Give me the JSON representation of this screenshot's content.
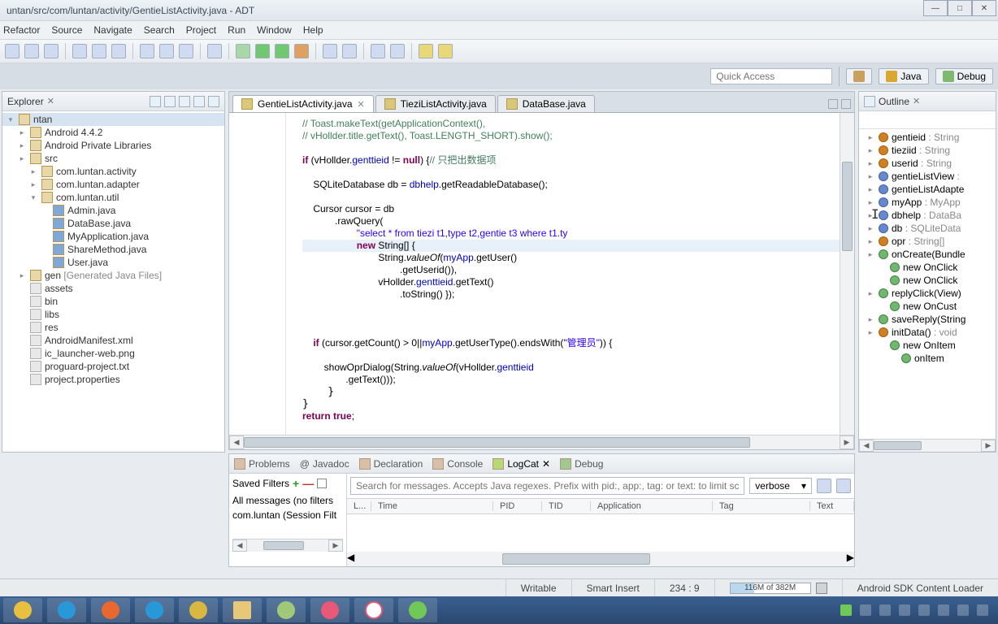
{
  "window": {
    "title": "untan/src/com/luntan/activity/GentieListActivity.java - ADT"
  },
  "menu": {
    "refactor": "Refactor",
    "source": "Source",
    "navigate": "Navigate",
    "search": "Search",
    "project": "Project",
    "run": "Run",
    "window": "Window",
    "help": "Help"
  },
  "perspective": {
    "quick_access": "Quick Access",
    "java": "Java",
    "debug": "Debug"
  },
  "explorer": {
    "title": "Explorer",
    "root": "ntan",
    "items": [
      {
        "l": 1,
        "k": "pkg",
        "t": "Android 4.4.2"
      },
      {
        "l": 1,
        "k": "pkg",
        "t": "Android Private Libraries"
      },
      {
        "l": 1,
        "k": "pkg",
        "t": "src"
      },
      {
        "l": 2,
        "k": "pkg",
        "t": "com.luntan.activity"
      },
      {
        "l": 2,
        "k": "pkg",
        "t": "com.luntan.adapter"
      },
      {
        "l": 2,
        "k": "pkg",
        "t": "com.luntan.util",
        "open": true
      },
      {
        "l": 3,
        "k": "java",
        "t": "Admin.java"
      },
      {
        "l": 3,
        "k": "java",
        "t": "DataBase.java"
      },
      {
        "l": 3,
        "k": "java",
        "t": "MyApplication.java"
      },
      {
        "l": 3,
        "k": "java",
        "t": "ShareMethod.java"
      },
      {
        "l": 3,
        "k": "java",
        "t": "User.java"
      },
      {
        "l": 1,
        "k": "gen",
        "t": "gen [Generated Java Files]"
      },
      {
        "l": 1,
        "k": "file",
        "t": "assets"
      },
      {
        "l": 1,
        "k": "file",
        "t": "bin"
      },
      {
        "l": 1,
        "k": "file",
        "t": "libs"
      },
      {
        "l": 1,
        "k": "file",
        "t": "res"
      },
      {
        "l": 1,
        "k": "file",
        "t": "AndroidManifest.xml"
      },
      {
        "l": 1,
        "k": "file",
        "t": "ic_launcher-web.png"
      },
      {
        "l": 1,
        "k": "file",
        "t": "proguard-project.txt"
      },
      {
        "l": 1,
        "k": "file",
        "t": "project.properties"
      }
    ]
  },
  "editor": {
    "tabs": [
      {
        "label": "GentieListActivity.java",
        "active": true
      },
      {
        "label": "TieziListActivity.java",
        "active": false
      },
      {
        "label": "DataBase.java",
        "active": false
      }
    ],
    "code_lines": [
      {
        "cls": "com",
        "txt": "// Toast.makeText(getApplicationContext(),"
      },
      {
        "cls": "com",
        "txt": "// vHollder.title.getText(), Toast.LENGTH_SHORT).show();"
      },
      {
        "cls": "",
        "txt": ""
      },
      {
        "cls": "mix",
        "parts": [
          {
            "c": "kw",
            "t": "if"
          },
          {
            "c": "",
            "t": " (vHollder."
          },
          {
            "c": "fld",
            "t": "genttieid"
          },
          {
            "c": "",
            "t": " != "
          },
          {
            "c": "kw",
            "t": "null"
          },
          {
            "c": "",
            "t": ") {"
          },
          {
            "c": "com",
            "t": "// 只把出数据项"
          }
        ]
      },
      {
        "cls": "",
        "txt": ""
      },
      {
        "cls": "mix",
        "parts": [
          {
            "c": "",
            "t": "    SQLiteDatabase db = "
          },
          {
            "c": "fld",
            "t": "dbhelp"
          },
          {
            "c": "",
            "t": ".getReadableDatabase();"
          }
        ]
      },
      {
        "cls": "",
        "txt": ""
      },
      {
        "cls": "mix",
        "parts": [
          {
            "c": "",
            "t": "    Cursor cursor = db"
          }
        ]
      },
      {
        "cls": "mix",
        "parts": [
          {
            "c": "",
            "t": "            .rawQuery("
          }
        ]
      },
      {
        "cls": "mix",
        "parts": [
          {
            "c": "",
            "t": "                    "
          },
          {
            "c": "str",
            "t": "\"select * from tiezi t1,type t2,gentie t3 where t1.ty"
          }
        ]
      },
      {
        "cls": "mix",
        "hl": true,
        "parts": [
          {
            "c": "",
            "t": "                    "
          },
          {
            "c": "kw",
            "t": "new"
          },
          {
            "c": "",
            "t": " String[] {"
          }
        ]
      },
      {
        "cls": "mix",
        "parts": [
          {
            "c": "",
            "t": "                            String."
          },
          {
            "c": "mth",
            "t": "valueOf"
          },
          {
            "c": "",
            "t": "("
          },
          {
            "c": "fld",
            "t": "myApp"
          },
          {
            "c": "",
            "t": ".getUser()"
          }
        ]
      },
      {
        "cls": "mix",
        "parts": [
          {
            "c": "",
            "t": "                                    .getUserid()),"
          }
        ]
      },
      {
        "cls": "mix",
        "parts": [
          {
            "c": "",
            "t": "                            vHollder."
          },
          {
            "c": "fld",
            "t": "genttieid"
          },
          {
            "c": "",
            "t": ".getText()"
          }
        ]
      },
      {
        "cls": "mix",
        "parts": [
          {
            "c": "",
            "t": "                                    .toString() });"
          }
        ]
      },
      {
        "cls": "",
        "txt": ""
      },
      {
        "cls": "",
        "txt": ""
      },
      {
        "cls": "",
        "txt": ""
      },
      {
        "cls": "mix",
        "parts": [
          {
            "c": "",
            "t": "    "
          },
          {
            "c": "kw",
            "t": "if"
          },
          {
            "c": "",
            "t": " (cursor.getCount() > 0||"
          },
          {
            "c": "fld",
            "t": "myApp"
          },
          {
            "c": "",
            "t": ".getUserType().endsWith("
          },
          {
            "c": "str",
            "t": "\"管理员\""
          },
          {
            "c": "",
            "t": ")) {"
          }
        ]
      },
      {
        "cls": "",
        "txt": ""
      },
      {
        "cls": "mix",
        "parts": [
          {
            "c": "",
            "t": "        showOprDialog(String."
          },
          {
            "c": "mth",
            "t": "valueOf"
          },
          {
            "c": "",
            "t": "(vHollder."
          },
          {
            "c": "fld",
            "t": "genttieid"
          }
        ]
      },
      {
        "cls": "mix",
        "parts": [
          {
            "c": "",
            "t": "                .getText()));"
          }
        ]
      },
      {
        "cls": "",
        "txt": "    }"
      },
      {
        "cls": "",
        "txt": "}"
      },
      {
        "cls": "mix",
        "parts": [
          {
            "c": "kw",
            "t": "return true"
          },
          {
            "c": "",
            "t": ";"
          }
        ]
      }
    ]
  },
  "outline": {
    "title": "Outline",
    "items": [
      {
        "l": 1,
        "k": "pr",
        "name": "gentieid",
        "type": ": String"
      },
      {
        "l": 1,
        "k": "pr",
        "name": "tieziid",
        "type": ": String"
      },
      {
        "l": 1,
        "k": "pr",
        "name": "userid",
        "type": ": String"
      },
      {
        "l": 1,
        "k": "df",
        "name": "gentieListView",
        "type": ":"
      },
      {
        "l": 1,
        "k": "df",
        "name": "gentieListAdapte",
        "type": ""
      },
      {
        "l": 1,
        "k": "df",
        "name": "myApp",
        "type": ": MyApp"
      },
      {
        "l": 1,
        "k": "df",
        "name": "dbhelp",
        "type": ": DataBa"
      },
      {
        "l": 1,
        "k": "df",
        "name": "db",
        "type": ": SQLiteData"
      },
      {
        "l": 1,
        "k": "pr",
        "name": "opr",
        "type": ": String[]"
      },
      {
        "l": 1,
        "k": "pu",
        "name": "onCreate(Bundle",
        "type": ""
      },
      {
        "l": 2,
        "k": "pu",
        "name": "new OnClick",
        "type": ""
      },
      {
        "l": 2,
        "k": "pu",
        "name": "new OnClick",
        "type": ""
      },
      {
        "l": 1,
        "k": "pu",
        "name": "replyClick(View)",
        "type": ""
      },
      {
        "l": 2,
        "k": "pu",
        "name": "new OnCust",
        "type": ""
      },
      {
        "l": 1,
        "k": "pu",
        "name": "saveReply(String",
        "type": ""
      },
      {
        "l": 1,
        "k": "pr",
        "name": "initData()",
        "type": ": void"
      },
      {
        "l": 2,
        "k": "pu",
        "name": "new OnItem",
        "type": ""
      },
      {
        "l": 3,
        "k": "pu",
        "name": "onItem",
        "type": ""
      }
    ]
  },
  "bottom": {
    "tabs": {
      "problems": "Problems",
      "javadoc": "Javadoc",
      "declaration": "Declaration",
      "console": "Console",
      "logcat": "LogCat",
      "debug": "Debug"
    },
    "saved_filters": "Saved Filters",
    "all_messages": "All messages (no filters",
    "session_filter": "com.luntan (Session Filt",
    "search_ph": "Search for messages. Accepts Java regexes. Prefix with pid:, app:, tag: or text: to limit scope.",
    "level": "verbose",
    "cols": {
      "l": "L...",
      "time": "Time",
      "pid": "PID",
      "tid": "TID",
      "app": "Application",
      "tag": "Tag",
      "text": "Text"
    }
  },
  "status": {
    "writable": "Writable",
    "insert": "Smart Insert",
    "pos": "234 : 9",
    "heap": "116M of 382M",
    "task": "Android SDK Content Loader"
  }
}
